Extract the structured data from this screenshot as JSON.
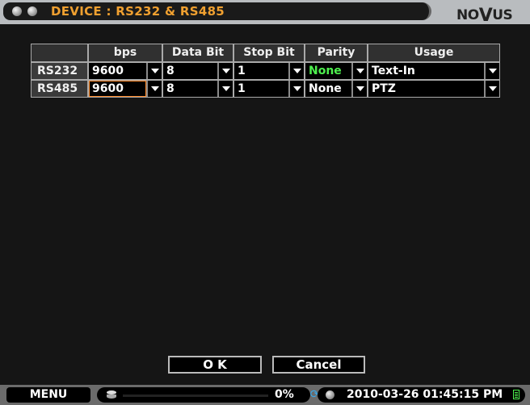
{
  "window": {
    "title": "DEVICE : RS232 & RS485",
    "brand": {
      "prefix": "NO",
      "v": "V",
      "suffix": "US"
    }
  },
  "table": {
    "headers": [
      "bps",
      "Data Bit",
      "Stop Bit",
      "Parity",
      "Usage"
    ],
    "rows": [
      {
        "label": "RS232",
        "bps": "9600",
        "data_bit": "8",
        "stop_bit": "1",
        "parity": "None",
        "usage": "Text-In"
      },
      {
        "label": "RS485",
        "bps": "9600",
        "data_bit": "8",
        "stop_bit": "1",
        "parity": "None",
        "usage": "PTZ"
      }
    ]
  },
  "buttons": {
    "ok": "O K",
    "cancel": "Cancel"
  },
  "statusbar": {
    "menu": "MENU",
    "hdd_usage_percent": 0,
    "hdd_label": "0%",
    "icons": [
      "sync-icon",
      "document-icon",
      "wrench-icon",
      "bell-icon",
      "disk-icon",
      "alert-icon"
    ],
    "datetime": "2010-03-26 01:45:15 PM"
  },
  "colors": {
    "title": "#f0a030",
    "highlight": "#4ef04e",
    "selection_border": "#ff8a2a"
  }
}
